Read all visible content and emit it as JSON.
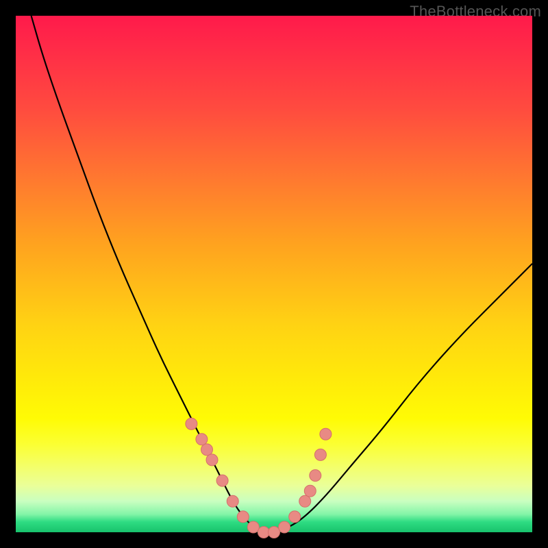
{
  "watermark": "TheBottleneck.com",
  "colors": {
    "curve_stroke": "#000000",
    "marker_fill": "#e88a84",
    "marker_stroke": "#d46f6a"
  },
  "chart_data": {
    "type": "line",
    "title": "",
    "xlabel": "",
    "ylabel": "",
    "xlim": [
      0,
      100
    ],
    "ylim": [
      0,
      100
    ],
    "series": [
      {
        "name": "bottleneck-curve",
        "x": [
          3,
          5,
          8,
          12,
          16,
          20,
          24,
          28,
          32,
          35,
          38,
          40,
          42,
          44,
          46,
          48,
          50,
          53,
          56,
          60,
          65,
          71,
          78,
          86,
          95,
          100
        ],
        "y": [
          100,
          93,
          84,
          73,
          62,
          52,
          43,
          34,
          26,
          20,
          14,
          10,
          6,
          3,
          1,
          0,
          0,
          1,
          3,
          7,
          13,
          20,
          29,
          38,
          47,
          52
        ]
      }
    ],
    "markers": {
      "name": "highlight-dots",
      "x": [
        34,
        36,
        37,
        38,
        40,
        42,
        44,
        46,
        48,
        50,
        52,
        54,
        56,
        57,
        58,
        59,
        60
      ],
      "y": [
        21,
        18,
        16,
        14,
        10,
        6,
        3,
        1,
        0,
        0,
        1,
        3,
        6,
        8,
        11,
        15,
        19
      ]
    }
  }
}
